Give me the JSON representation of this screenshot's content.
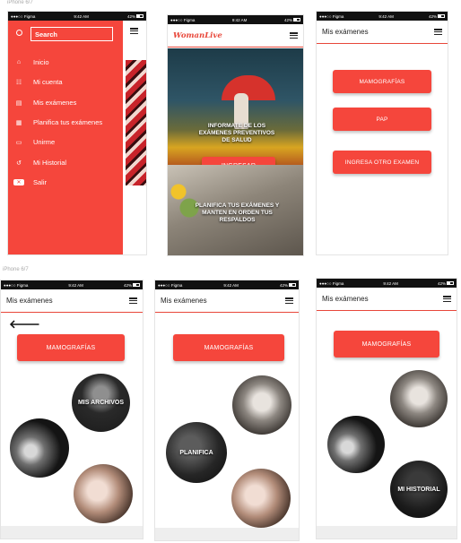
{
  "caption": "iPhone 6/7",
  "status": {
    "carrier": "●●●○○ Figma",
    "time": "9:42 AM",
    "battery": "42%"
  },
  "sidebar": {
    "search_placeholder": "Search",
    "items": [
      {
        "label": "Inicio",
        "icon": "home-icon"
      },
      {
        "label": "Mi cuenta",
        "icon": "account-icon"
      },
      {
        "label": "Mis exámenes",
        "icon": "exams-icon"
      },
      {
        "label": "Planifica tus exámenes",
        "icon": "calendar-icon"
      },
      {
        "label": "Unirme",
        "icon": "card-icon"
      },
      {
        "label": "Mi Historial",
        "icon": "history-icon"
      },
      {
        "label": "Salir",
        "icon": "exit-icon"
      }
    ]
  },
  "home": {
    "logo": "WomanLive",
    "hero_text": "INFORMATE DE LOS EXÁMENES PREVENTIVOS DE SALUD",
    "login_button": "INGRESAR",
    "plan_text": "PLANIFICA TUS EXÁMENES Y MANTEN EN ORDEN TUS RESPALDOS"
  },
  "exams": {
    "title": "Mis exámenes",
    "buttons": [
      "MAMOGRAFÍAS",
      "PAP",
      "INGRESA OTRO EXAMEN"
    ]
  },
  "mamo": {
    "title": "Mis exámenes",
    "button": "MAMOGRAFÍAS",
    "circle_archivos": "MIS ARCHIVOS",
    "circle_planifica": "PLANIFICA",
    "circle_historial": "MI HISTORIAL"
  },
  "colors": {
    "accent": "#f5463c",
    "sidebar": "#f5463c"
  }
}
